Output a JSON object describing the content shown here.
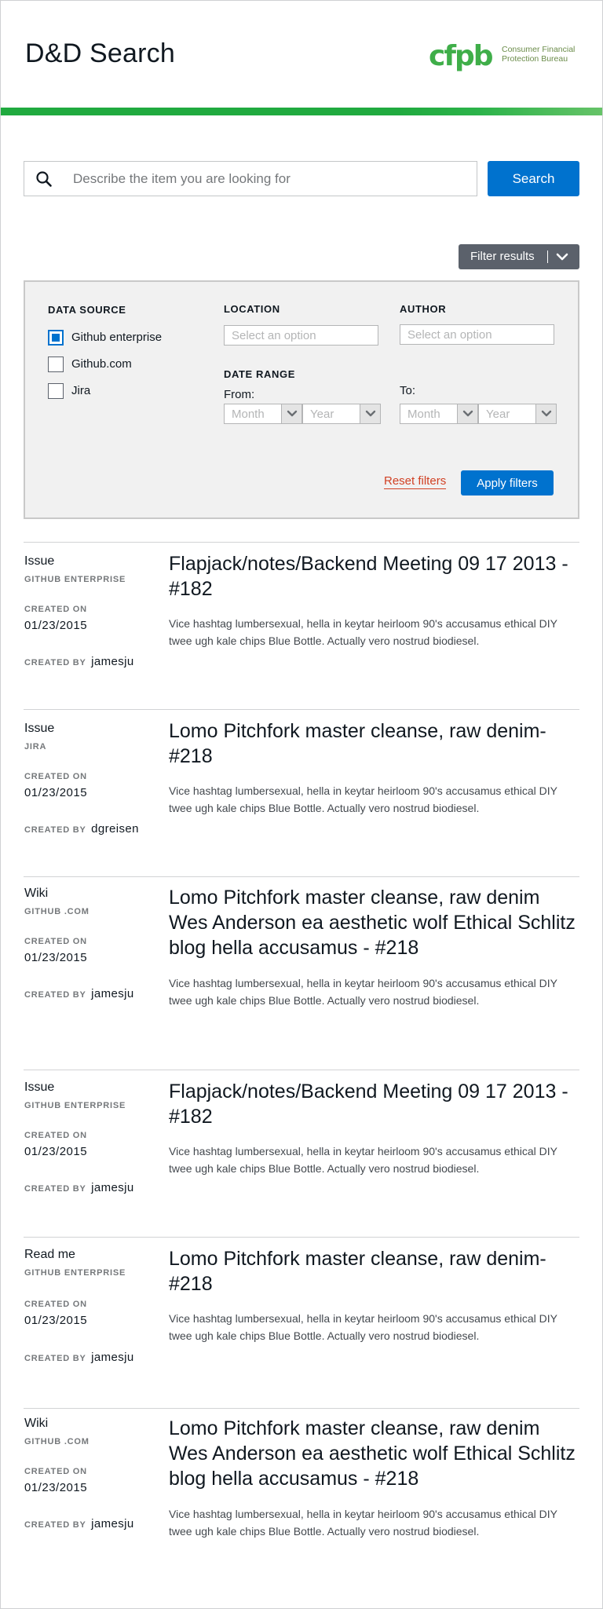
{
  "header": {
    "title": "D&D Search",
    "logo_text_line1": "Consumer Financial",
    "logo_text_line2": "Protection Bureau",
    "logo_word": "cfpb"
  },
  "search": {
    "placeholder": "Describe the item you are looking for",
    "value": "",
    "button_label": "Search"
  },
  "filter_toggle": {
    "label": "Filter results",
    "icon": "chevron-down-icon"
  },
  "filters": {
    "data_source_heading": "DATA SOURCE",
    "sources": [
      {
        "label": "Github enterprise",
        "checked": true
      },
      {
        "label": "Github.com",
        "checked": false
      },
      {
        "label": "Jira",
        "checked": false
      }
    ],
    "location_heading": "LOCATION",
    "location_placeholder": "Select an option",
    "author_heading": "AUTHOR",
    "author_placeholder": "Select an option",
    "date_range_heading": "DATE RANGE",
    "from_label": "From:",
    "to_label": "To:",
    "month_placeholder": "Month",
    "year_placeholder": "Year",
    "reset_label": "Reset filters",
    "apply_label": "Apply filters"
  },
  "result_labels": {
    "created_on": "CREATED ON",
    "created_by": "CREATED BY"
  },
  "results": [
    {
      "type": "Issue",
      "source": "GITHUB ENTERPRISE",
      "date": "01/23/2015",
      "author": "jamesju",
      "title": "Flapjack/notes/Backend Meeting 09 17 2013 - #182",
      "description": "Vice hashtag lumbersexual, hella in keytar heirloom 90's accusamus ethical DIY twee ugh kale chips Blue Bottle. Actually vero nostrud biodiesel."
    },
    {
      "type": "Issue",
      "source": "JIRA",
      "date": "01/23/2015",
      "author": "dgreisen",
      "title": "Lomo Pitchfork master cleanse, raw denim- #218",
      "description": "Vice hashtag lumbersexual, hella in keytar heirloom 90's accusamus ethical DIY twee ugh kale chips Blue Bottle. Actually vero nostrud biodiesel."
    },
    {
      "type": "Wiki",
      "source": "GITHUB .COM",
      "date": "01/23/2015",
      "author": "jamesju",
      "title": "Lomo Pitchfork master cleanse, raw denim Wes Anderson ea aesthetic wolf Ethical Schlitz blog hella accusamus - #218",
      "description": "Vice hashtag lumbersexual, hella in keytar heirloom 90's accusamus ethical DIY twee ugh kale chips Blue Bottle. Actually vero nostrud biodiesel."
    },
    {
      "type": "Issue",
      "source": "GITHUB ENTERPRISE",
      "date": "01/23/2015",
      "author": "jamesju",
      "title": "Flapjack/notes/Backend Meeting 09 17 2013 - #182",
      "description": "Vice hashtag lumbersexual, hella in keytar heirloom 90's accusamus ethical DIY twee ugh kale chips Blue Bottle. Actually vero nostrud biodiesel."
    },
    {
      "type": "Read me",
      "source": "GITHUB ENTERPRISE",
      "date": "01/23/2015",
      "author": "jamesju",
      "title": "Lomo Pitchfork master cleanse, raw denim- #218",
      "description": "Vice hashtag lumbersexual, hella in keytar heirloom 90's accusamus ethical DIY twee ugh kale chips Blue Bottle. Actually vero nostrud biodiesel."
    },
    {
      "type": "Wiki",
      "source": "GITHUB .COM",
      "date": "01/23/2015",
      "author": "jamesju",
      "title": "Lomo Pitchfork master cleanse, raw denim Wes Anderson ea aesthetic wolf Ethical Schlitz blog hella accusamus - #218",
      "description": "Vice hashtag lumbersexual, hella in keytar heirloom 90's accusamus ethical DIY twee ugh kale chips Blue Bottle. Actually vero nostrud biodiesel."
    }
  ],
  "colors": {
    "brand_green": "#20aa3f",
    "primary_blue": "#0072ce",
    "reset_red": "#d14124",
    "toggle_gray": "#5b616b"
  }
}
